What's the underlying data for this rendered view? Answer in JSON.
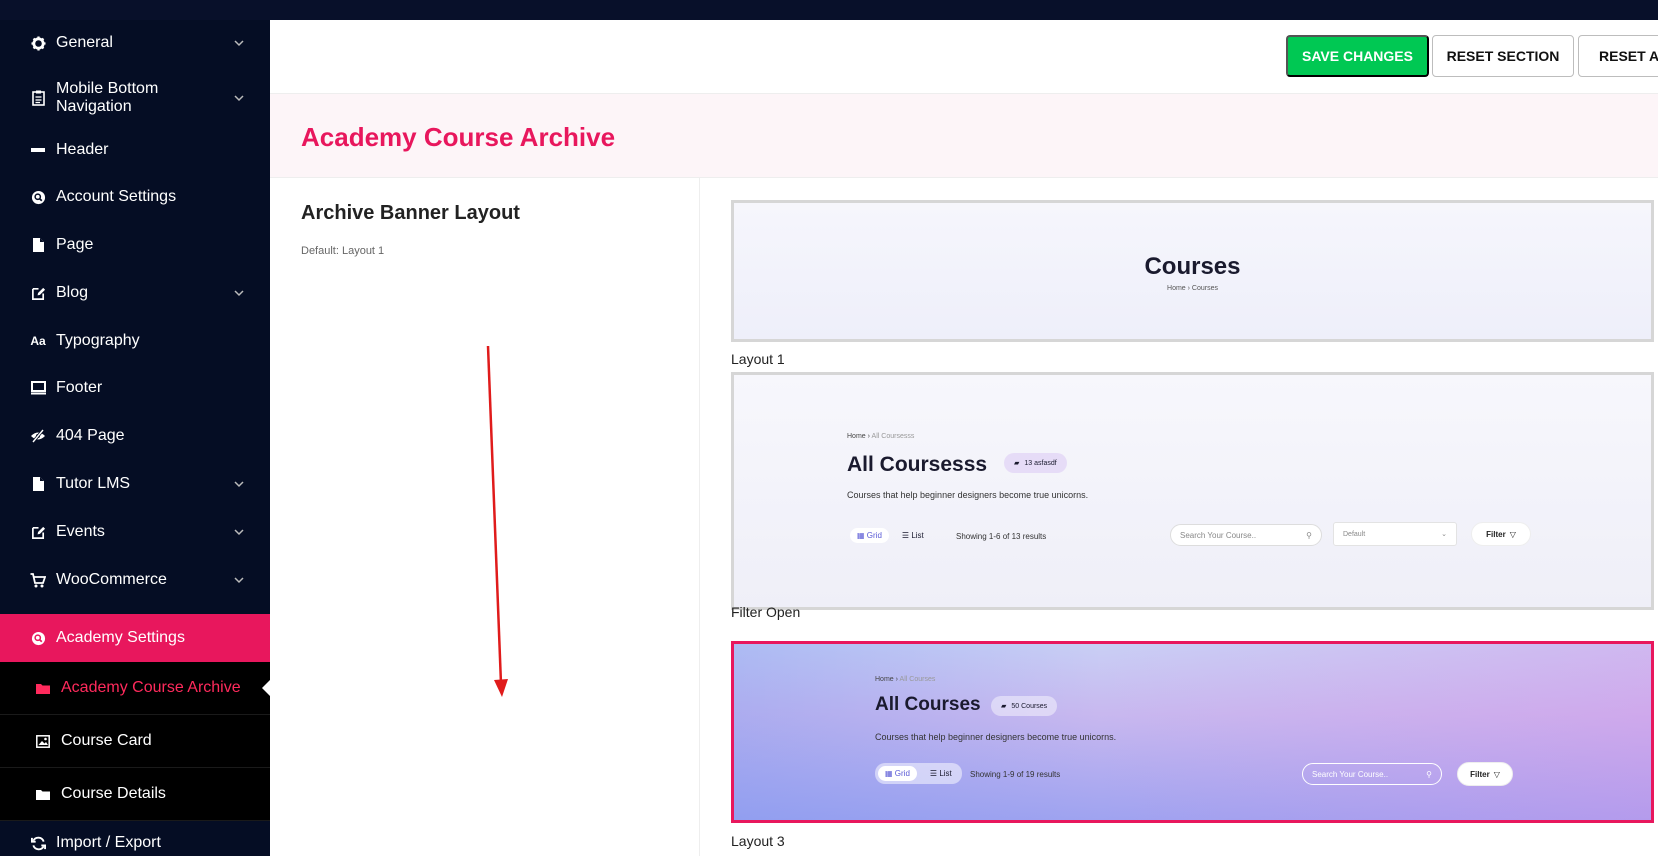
{
  "sidebar": {
    "items": [
      {
        "label": "General",
        "icon": "gear-icon",
        "has_children": true
      },
      {
        "label": "Mobile Bottom Navigation",
        "icon": "clipboard-icon",
        "has_children": true
      },
      {
        "label": "Header",
        "icon": "minus-icon",
        "has_children": false
      },
      {
        "label": "Account Settings",
        "icon": "search-circle-icon",
        "has_children": false
      },
      {
        "label": "Page",
        "icon": "file-icon",
        "has_children": false
      },
      {
        "label": "Blog",
        "icon": "edit-icon",
        "has_children": true
      },
      {
        "label": "Typography",
        "icon": "font-icon",
        "icon_text": "Aa",
        "has_children": false
      },
      {
        "label": "Footer",
        "icon": "monitor-icon",
        "has_children": false
      },
      {
        "label": "404 Page",
        "icon": "eye-slash-icon",
        "has_children": false
      },
      {
        "label": "Tutor LMS",
        "icon": "file-icon",
        "has_children": true
      },
      {
        "label": "Events",
        "icon": "edit-icon",
        "has_children": true
      },
      {
        "label": "WooCommerce",
        "icon": "cart-icon",
        "has_children": true
      },
      {
        "label": "Academy Settings",
        "icon": "search-circle-icon",
        "has_children": false,
        "active": true
      },
      {
        "label": "Import / Export",
        "icon": "refresh-icon",
        "has_children": false
      }
    ],
    "sub_items": [
      {
        "label": "Academy Course Archive",
        "icon": "folder-icon",
        "current": true
      },
      {
        "label": "Course Card",
        "icon": "image-icon",
        "current": false
      },
      {
        "label": "Course Details",
        "icon": "folder-icon",
        "current": false
      }
    ]
  },
  "toolbar": {
    "save_label": "SAVE CHANGES",
    "reset_section_label": "RESET SECTION",
    "reset_all_label": "RESET AL"
  },
  "section": {
    "title": "Academy Course Archive"
  },
  "field": {
    "title": "Archive Banner Layout",
    "description": "Default: Layout 1"
  },
  "layouts": [
    {
      "label": "Layout 1",
      "selected": false,
      "preview": {
        "title": "Courses",
        "breadcrumb": "Home › Courses"
      }
    },
    {
      "label": "Filter Open",
      "selected": false,
      "preview": {
        "crumb_home": "Home",
        "crumb_sep": "›",
        "crumb_current": "All Coursesss",
        "title": "All Coursesss",
        "badge": "13 asfasdf",
        "subtitle": "Courses that help beginner designers become true unicorns.",
        "tab_grid": "Grid",
        "tab_list": "List",
        "results": "Showing 1-6 of 13 results",
        "search_placeholder": "Search Your Course..",
        "select_value": "Default",
        "filter_label": "Filter"
      }
    },
    {
      "label": "Layout 3",
      "selected": true,
      "preview": {
        "crumb_home": "Home",
        "crumb_sep": "›",
        "crumb_current": "All Courses",
        "title": "All Courses",
        "badge": "50 Courses",
        "subtitle": "Courses that help beginner designers become true unicorns.",
        "tab_grid": "Grid",
        "tab_list": "List",
        "results": "Showing 1-9 of 19 results",
        "search_placeholder": "Search Your Course..",
        "filter_label": "Filter"
      }
    }
  ],
  "colors": {
    "sidebar_bg": "#050d24",
    "accent": "#e8175d",
    "save_green": "#00c853",
    "annotation_arrow": "#e01b1b"
  }
}
